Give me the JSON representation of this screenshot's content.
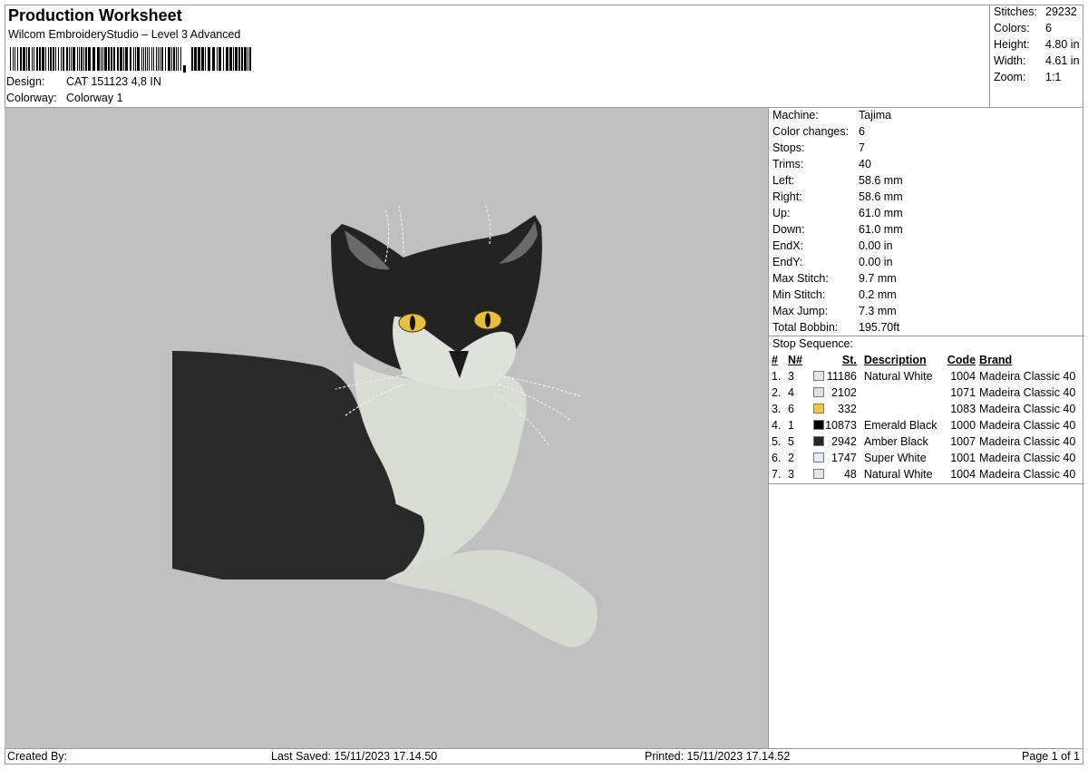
{
  "header": {
    "title": "Production Worksheet",
    "subtitle": "Wilcom EmbroideryStudio – Level 3 Advanced",
    "design_label": "Design:",
    "design_value": "CAT 151123 4,8 IN",
    "colorway_label": "Colorway:",
    "colorway_value": "Colorway 1"
  },
  "stats": [
    {
      "label": "Stitches:",
      "value": "29232"
    },
    {
      "label": "Colors:",
      "value": "6"
    },
    {
      "label": "Height:",
      "value": "4.80 in"
    },
    {
      "label": "Width:",
      "value": "4.61 in"
    },
    {
      "label": "Zoom:",
      "value": "1:1"
    }
  ],
  "machine_info": [
    {
      "label": "Machine:",
      "value": "Tajima"
    },
    {
      "label": "Color changes:",
      "value": "6"
    },
    {
      "label": "Stops:",
      "value": "7"
    },
    {
      "label": "Trims:",
      "value": "40"
    },
    {
      "label": "Left:",
      "value": "58.6 mm"
    },
    {
      "label": "Right:",
      "value": "58.6 mm"
    },
    {
      "label": "Up:",
      "value": "61.0 mm"
    },
    {
      "label": "Down:",
      "value": "61.0 mm"
    },
    {
      "label": "EndX:",
      "value": "0.00 in"
    },
    {
      "label": "EndY:",
      "value": "0.00 in"
    },
    {
      "label": "Max Stitch:",
      "value": "9.7 mm"
    },
    {
      "label": "Min Stitch:",
      "value": "0.2 mm"
    },
    {
      "label": "Max Jump:",
      "value": "7.3 mm"
    },
    {
      "label": "Total Bobbin:",
      "value": "195.70ft"
    }
  ],
  "stop_sequence": {
    "title": "Stop Sequence:",
    "headers": {
      "num": "#",
      "n": "N#",
      "st": "St.",
      "description": "Description",
      "code": "Code",
      "brand": "Brand"
    },
    "rows": [
      {
        "num": "1.",
        "n": "3",
        "color": "#e6e6e6",
        "st": "11186",
        "description": "Natural White",
        "code": "1004",
        "brand": "Madeira Classic 40"
      },
      {
        "num": "2.",
        "n": "4",
        "color": "#e3ded6",
        "st": "2102",
        "description": "",
        "code": "1071",
        "brand": "Madeira Classic 40"
      },
      {
        "num": "3.",
        "n": "6",
        "color": "#f2c641",
        "st": "332",
        "description": "",
        "code": "1083",
        "brand": "Madeira Classic 40"
      },
      {
        "num": "4.",
        "n": "1",
        "color": "#000000",
        "st": "10873",
        "description": "Emerald Black",
        "code": "1000",
        "brand": "Madeira Classic 40"
      },
      {
        "num": "5.",
        "n": "5",
        "color": "#262626",
        "st": "2942",
        "description": "Amber Black",
        "code": "1007",
        "brand": "Madeira Classic 40"
      },
      {
        "num": "6.",
        "n": "2",
        "color": "#e6ecf8",
        "st": "1747",
        "description": "Super White",
        "code": "1001",
        "brand": "Madeira Classic 40"
      },
      {
        "num": "7.",
        "n": "3",
        "color": "#e6e6e6",
        "st": "48",
        "description": "Natural White",
        "code": "1004",
        "brand": "Madeira Classic 40"
      }
    ]
  },
  "footer": {
    "created_by": "Created By:",
    "last_saved": "Last Saved: 15/11/2023 17.14.50",
    "printed": "Printed: 15/11/2023 17.14.52",
    "page": "Page 1 of 1"
  },
  "preview": {
    "background": "#c0c0c0"
  }
}
